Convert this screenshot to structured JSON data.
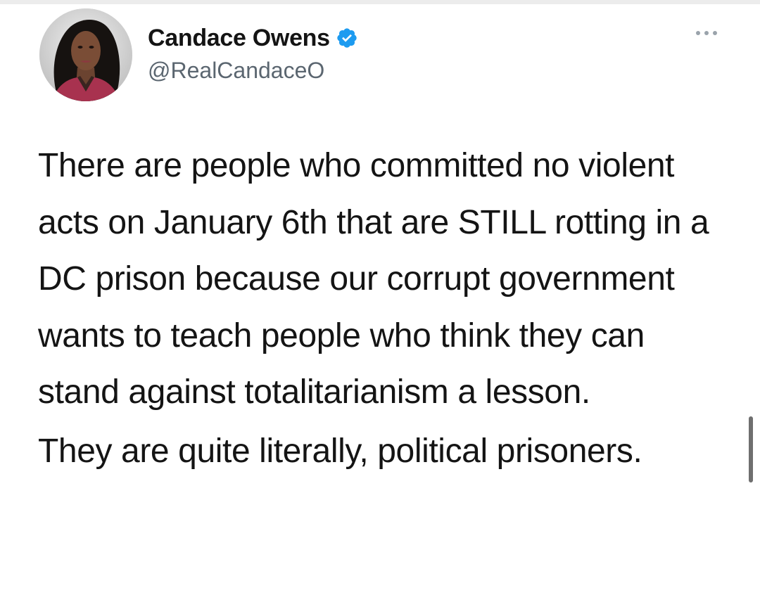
{
  "tweet": {
    "display_name": "Candace Owens",
    "handle": "@RealCandaceO",
    "verified": true,
    "paragraphs": [
      "There are people who committed no violent acts on January 6th that are STILL rotting in a DC prison because our corrupt government wants to teach people who think they can stand against totalitarianism a lesson.",
      "They are quite literally, political prisoners."
    ]
  },
  "icons": {
    "verified": "verified-badge-icon",
    "more": "more-options-icon"
  },
  "colors": {
    "text": "#141414",
    "handle": "#5b6670",
    "verified_blue": "#1d9bf0",
    "background": "#ffffff"
  }
}
